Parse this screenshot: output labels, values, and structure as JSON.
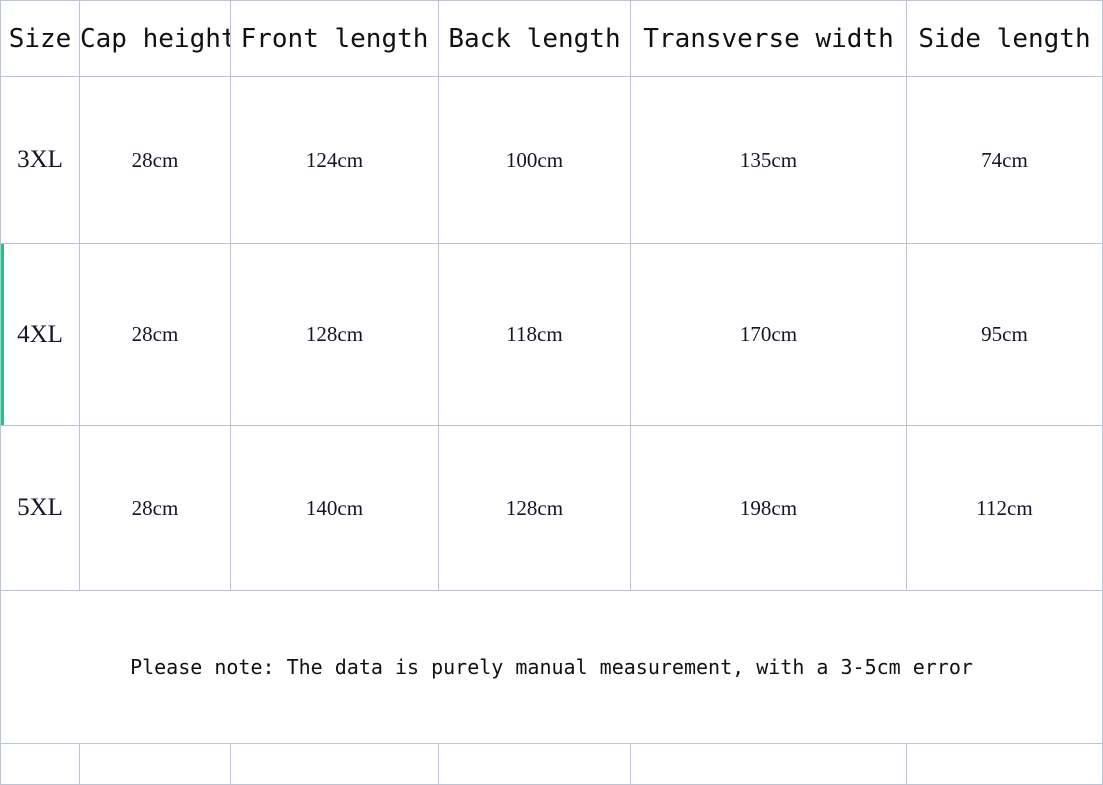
{
  "table": {
    "columns": [
      {
        "key": "size",
        "label": "Size"
      },
      {
        "key": "cap",
        "label": "Cap height"
      },
      {
        "key": "front",
        "label": "Front length"
      },
      {
        "key": "back",
        "label": "Back length"
      },
      {
        "key": "transverse",
        "label": "Transverse width"
      },
      {
        "key": "side",
        "label": "Side length"
      }
    ],
    "rows": [
      {
        "size": "3XL",
        "cap": "28cm",
        "front": "124cm",
        "back": "100cm",
        "transverse": "135cm",
        "side": "74cm",
        "highlighted": false
      },
      {
        "size": "4XL",
        "cap": "28cm",
        "front": "128cm",
        "back": "118cm",
        "transverse": "170cm",
        "side": "95cm",
        "highlighted": true
      },
      {
        "size": "5XL",
        "cap": "28cm",
        "front": "140cm",
        "back": "128cm",
        "transverse": "198cm",
        "side": "112cm",
        "highlighted": false
      }
    ],
    "note": "Please note: The data is purely manual measurement, with a 3-5cm error"
  },
  "colors": {
    "border": "#b9c3d9",
    "accent": "#2ebd7e",
    "text": "#14142b",
    "background": "#ffffff"
  }
}
